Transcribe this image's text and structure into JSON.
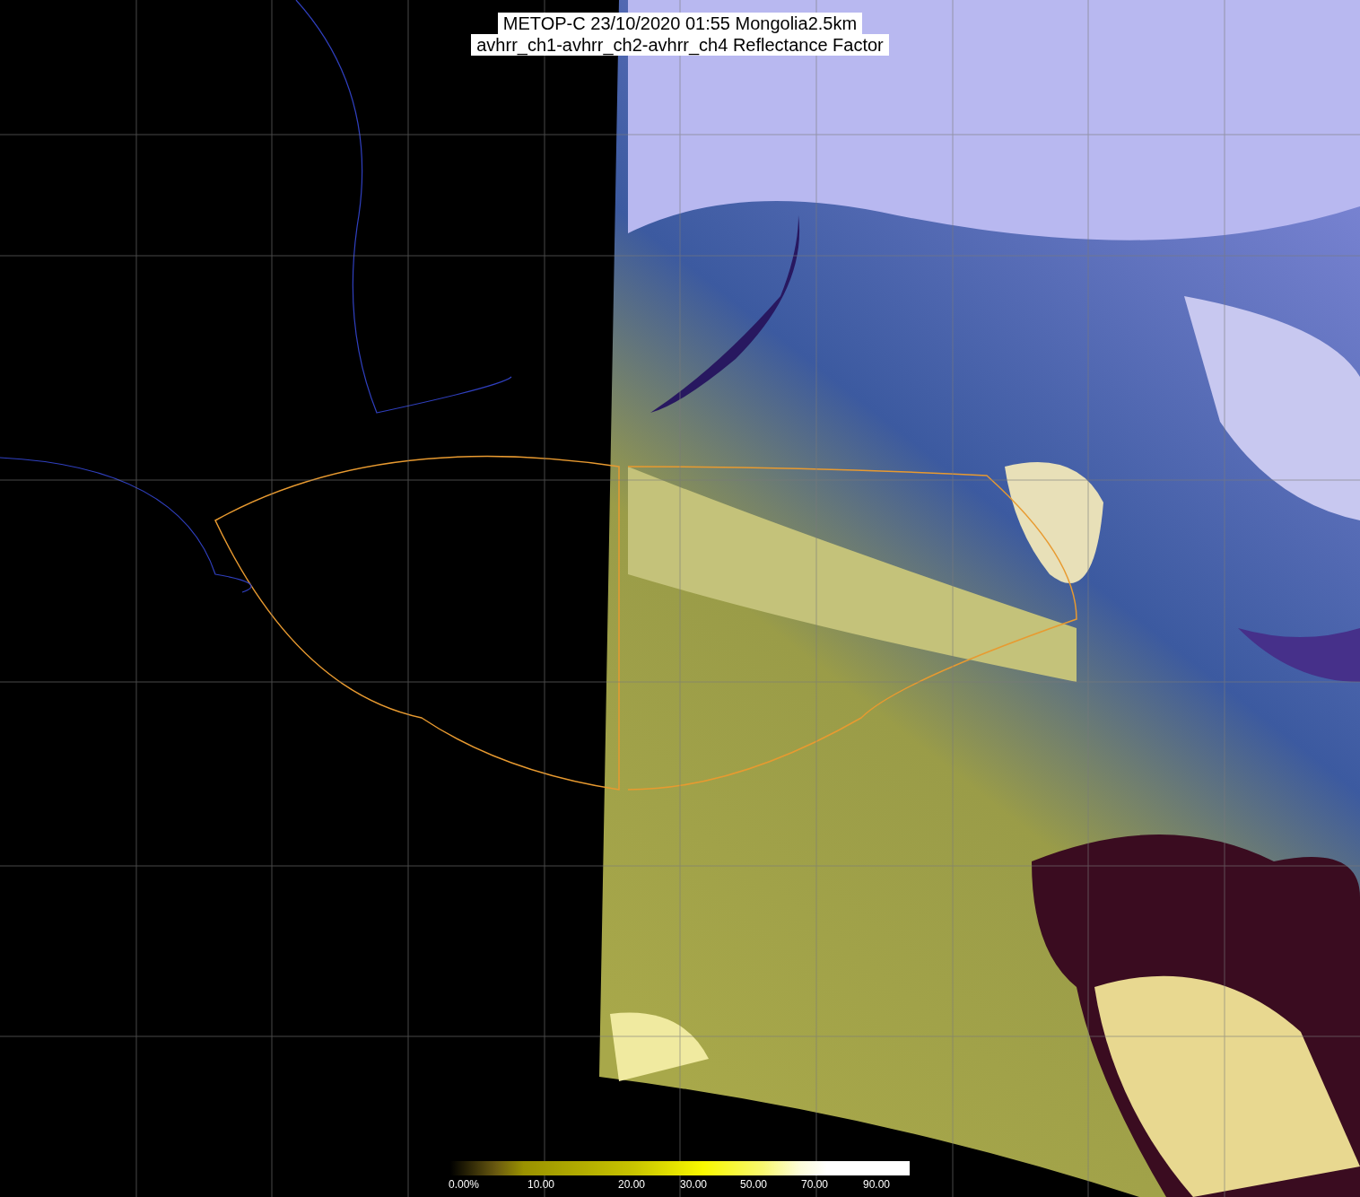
{
  "title": {
    "lines": [
      "METOP-C 23/10/2020 01:55 Mongolia2.5km",
      "avhrr_ch1-avhrr_ch2-avhrr_ch4 Reflectance Factor"
    ]
  },
  "colorbar": {
    "labels": [
      "0.00%",
      "10.00",
      "20.00",
      "30.00",
      "50.00",
      "70.00",
      "90.00"
    ]
  }
}
